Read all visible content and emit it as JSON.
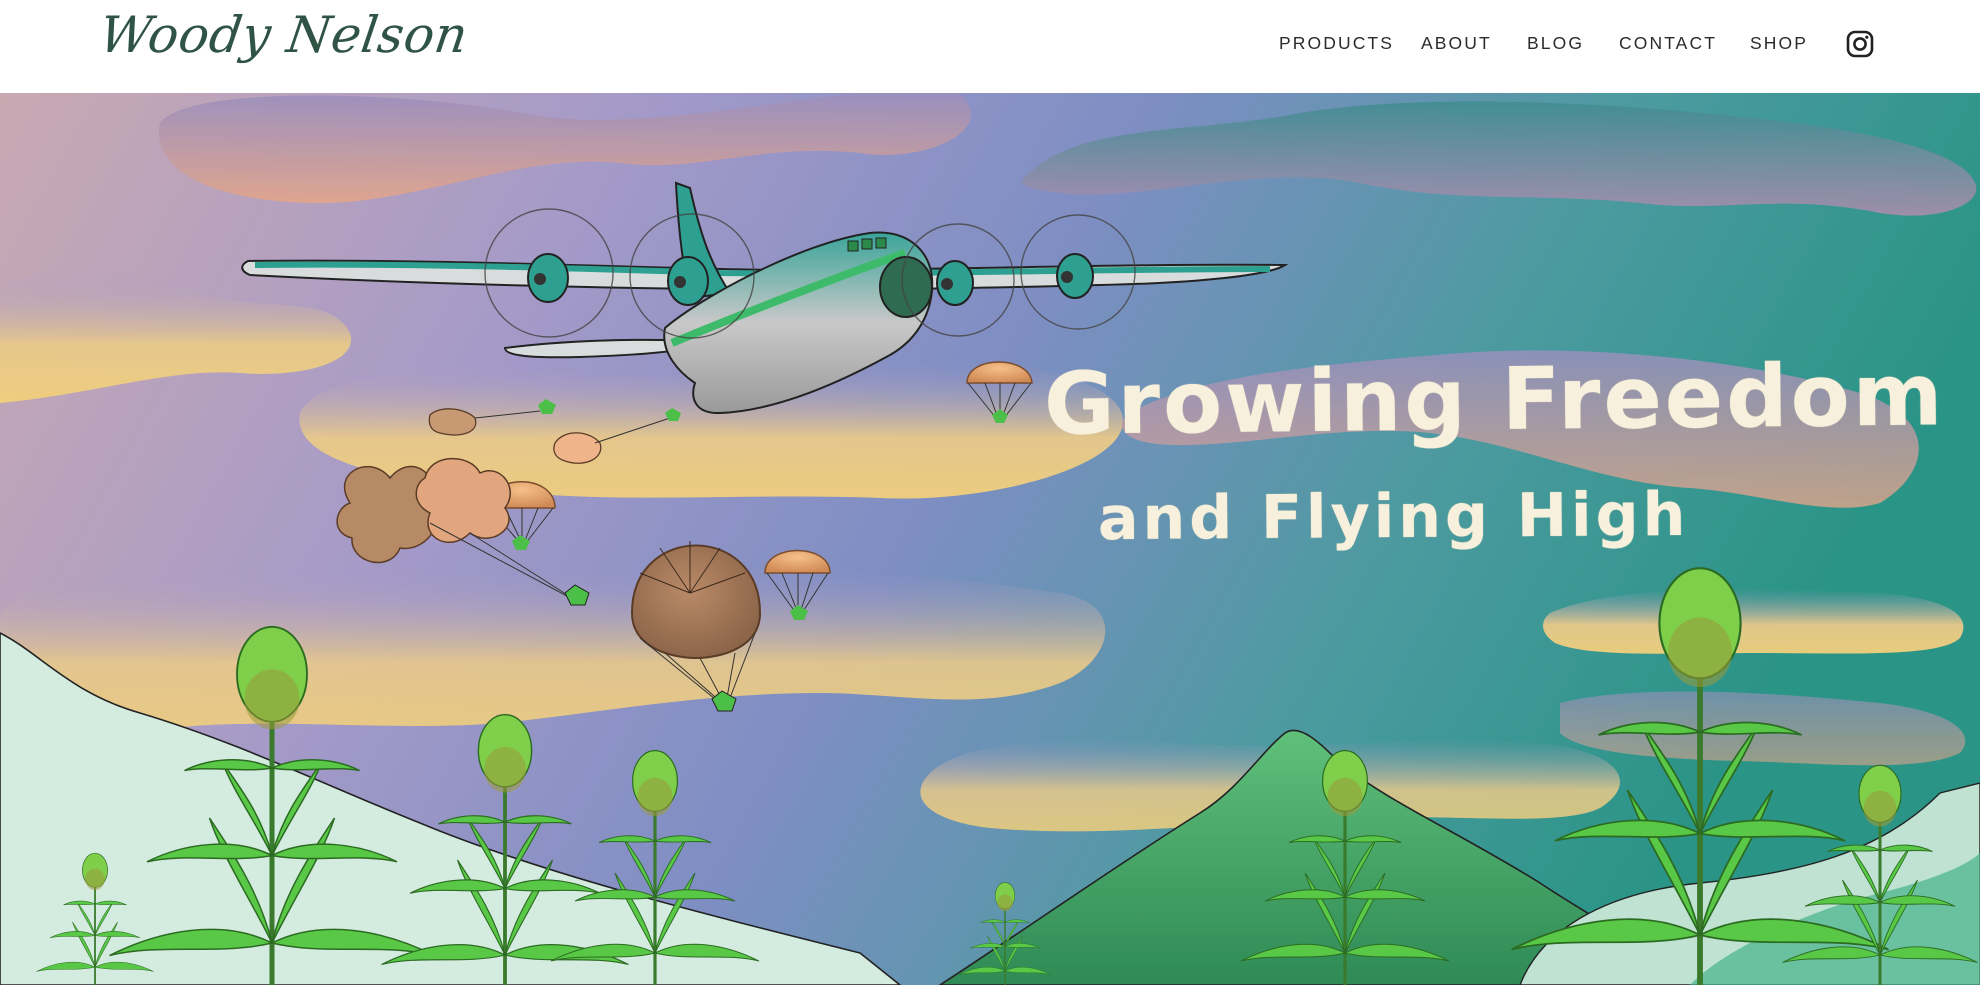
{
  "header": {
    "logo_text": "Woody Nelson",
    "nav": [
      {
        "label": "PRODUCTS"
      },
      {
        "label": "ABOUT"
      },
      {
        "label": "BLOG"
      },
      {
        "label": "CONTACT"
      },
      {
        "label": "SHOP"
      }
    ],
    "social_icon": "instagram-icon"
  },
  "hero": {
    "headline_line1": "Growing Freedom",
    "headline_line2": "and Flying High",
    "illustration": "cargo-plane-dropping-cannabis-parachutes"
  },
  "colors": {
    "logo": "#2f5446",
    "nav_text": "#2b2b2b",
    "headline": "#f7f0dc",
    "sky_purple": "#9b93c8",
    "sky_teal": "#2f8f86",
    "hill_green": "#3fa064",
    "plant_green": "#5ac847"
  }
}
